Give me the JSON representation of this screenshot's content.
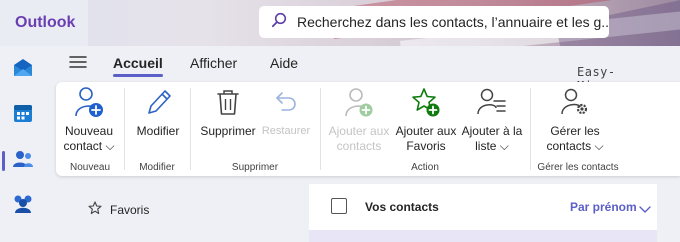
{
  "header": {
    "app_name": "Outlook",
    "search_placeholder": "Recherchez dans les contacts, l’annuaire et les g..."
  },
  "rail": {
    "items": [
      {
        "name": "mail",
        "icon": "mail-icon"
      },
      {
        "name": "calendar",
        "icon": "calendar-icon"
      },
      {
        "name": "people",
        "icon": "people-icon",
        "active": true
      },
      {
        "name": "teams",
        "icon": "teams-icon"
      }
    ]
  },
  "tabs": [
    {
      "label": "Accueil",
      "active": true
    },
    {
      "label": "Afficher"
    },
    {
      "label": "Aide"
    }
  ],
  "watermark": "Easy-Micro.org",
  "ribbon": {
    "new_contact": {
      "line1": "Nouveau",
      "line2": "contact ⌵"
    },
    "edit": {
      "label": "Modifier"
    },
    "delete": {
      "label": "Supprimer"
    },
    "restore": {
      "label": "Restaurer"
    },
    "add_to_contacts": {
      "line1": "Ajouter aux",
      "line2": "contacts"
    },
    "add_to_favorites": {
      "line1": "Ajouter aux",
      "line2": "Favoris"
    },
    "add_to_list": {
      "line1": "Ajouter à la",
      "line2": "liste ⌵"
    },
    "manage_contacts": {
      "line1": "Gérer les",
      "line2": "contacts ⌵"
    },
    "groups": {
      "new": "Nouveau",
      "edit": "Modifier",
      "delete": "Supprimer",
      "action": "Action",
      "manage": "Gérer les contacts"
    }
  },
  "nav": {
    "favorites": "Favoris"
  },
  "list": {
    "title": "Vos contacts",
    "sort": "Par prénom"
  },
  "colors": {
    "accent": "#5b5fc7",
    "brand": "#6b3fb2",
    "green": "#107c10"
  }
}
